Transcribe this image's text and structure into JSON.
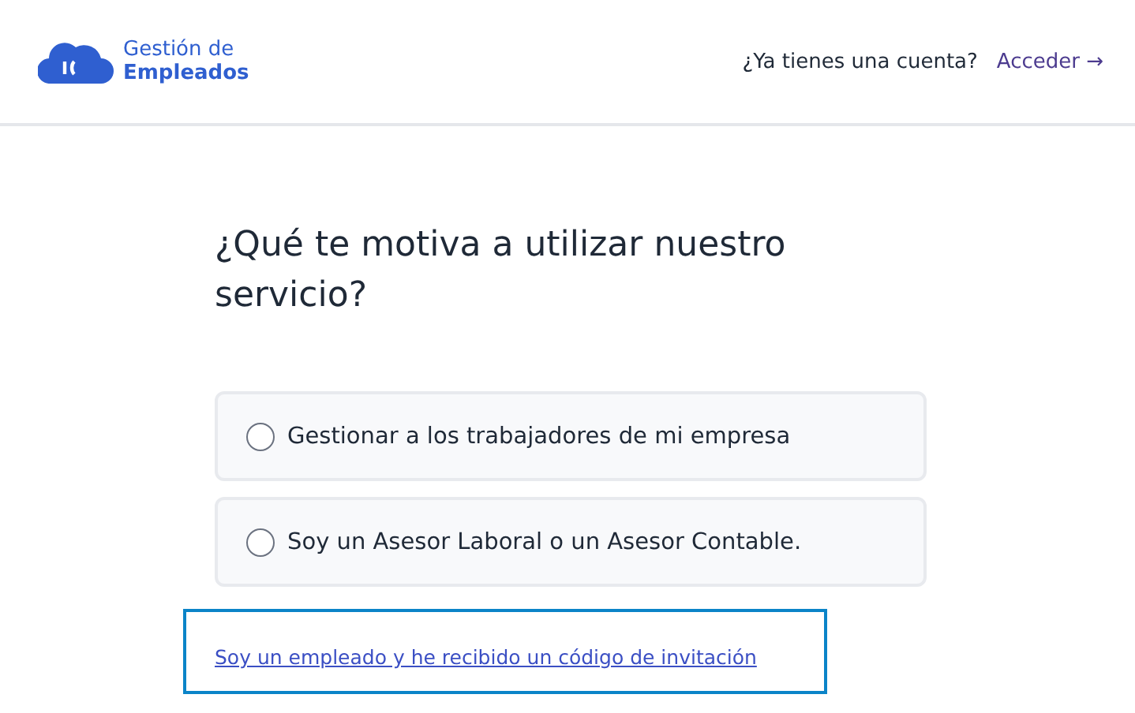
{
  "header": {
    "logo": {
      "line_1": "Gestión de",
      "line_2": "Empleados"
    },
    "account_prompt": "¿Ya tienes una cuenta?",
    "login_link": "Acceder →"
  },
  "question": "¿Qué te motiva a utilizar nuestro servicio?",
  "options": [
    {
      "label": "Gestionar a los trabajadores de mi empresa",
      "selected": false
    },
    {
      "label": "Soy un Asesor Laboral o un Asesor Contable.",
      "selected": false
    }
  ],
  "invitation_link": "Soy un empleado y he recibido un código de invitación"
}
